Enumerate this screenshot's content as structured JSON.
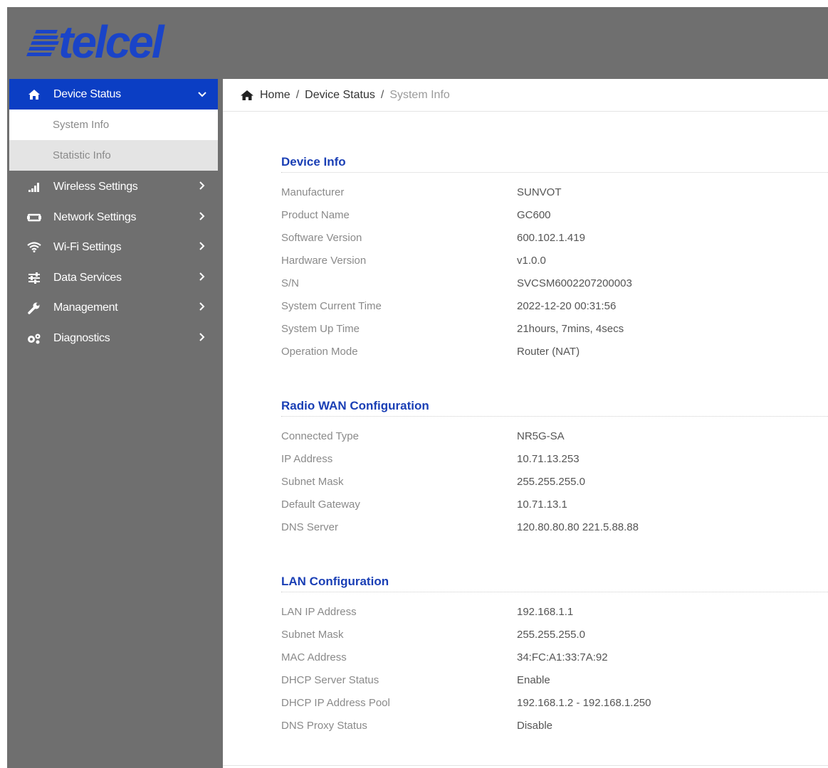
{
  "logo": {
    "text": "telcel"
  },
  "colors": {
    "brand": "#1a44c8",
    "sidebar": "#6f6f6f",
    "active": "#0b3ec4",
    "section_title": "#1a3fb5"
  },
  "sidebar": {
    "active": {
      "label": "Device Status",
      "icon": "home-icon",
      "chevron": "⌄"
    },
    "sub_items": [
      {
        "label": "System Info"
      },
      {
        "label": "Statistic Info"
      }
    ],
    "items": [
      {
        "label": "Wireless Settings",
        "icon": "signal-bars-icon"
      },
      {
        "label": "Network Settings",
        "icon": "network-icon"
      },
      {
        "label": "Wi-Fi Settings",
        "icon": "wifi-icon"
      },
      {
        "label": "Data Services",
        "icon": "sliders-icon"
      },
      {
        "label": "Management",
        "icon": "wrench-icon"
      },
      {
        "label": "Diagnostics",
        "icon": "gears-icon"
      }
    ]
  },
  "breadcrumb": {
    "home": "Home",
    "sep": "/",
    "parent": "Device Status",
    "current": "System Info"
  },
  "sections": {
    "device_info": {
      "title": "Device Info",
      "rows": [
        {
          "label": "Manufacturer",
          "value": "SUNVOT"
        },
        {
          "label": "Product Name",
          "value": "GC600"
        },
        {
          "label": "Software Version",
          "value": "600.102.1.419"
        },
        {
          "label": "Hardware Version",
          "value": "v1.0.0"
        },
        {
          "label": "S/N",
          "value": "SVCSM6002207200003"
        },
        {
          "label": "System Current Time",
          "value": "2022-12-20 00:31:56"
        },
        {
          "label": "System Up Time",
          "value": "21hours, 7mins, 4secs"
        },
        {
          "label": "Operation Mode",
          "value": "Router (NAT)"
        }
      ]
    },
    "radio_wan": {
      "title": "Radio WAN Configuration",
      "rows": [
        {
          "label": "Connected Type",
          "value": "NR5G-SA"
        },
        {
          "label": "IP Address",
          "value": "10.71.13.253"
        },
        {
          "label": "Subnet Mask",
          "value": "255.255.255.0"
        },
        {
          "label": "Default Gateway",
          "value": "10.71.13.1"
        },
        {
          "label": "DNS Server",
          "value": "120.80.80.80 221.5.88.88"
        }
      ]
    },
    "lan": {
      "title": "LAN Configuration",
      "rows": [
        {
          "label": "LAN IP Address",
          "value": "192.168.1.1"
        },
        {
          "label": "Subnet Mask",
          "value": "255.255.255.0"
        },
        {
          "label": "MAC Address",
          "value": "34:FC:A1:33:7A:92"
        },
        {
          "label": "DHCP Server Status",
          "value": "Enable"
        },
        {
          "label": "DHCP IP Address Pool",
          "value": "192.168.1.2 - 192.168.1.250"
        },
        {
          "label": "DNS Proxy Status",
          "value": "Disable"
        }
      ]
    }
  }
}
